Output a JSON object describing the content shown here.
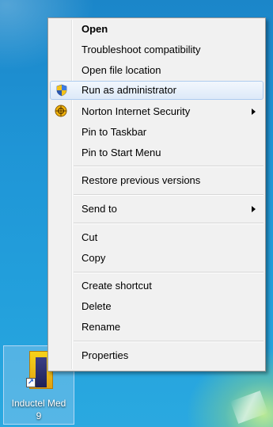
{
  "menu": {
    "items": [
      {
        "label": "Open"
      },
      {
        "label": "Troubleshoot compatibility"
      },
      {
        "label": "Open file location"
      },
      {
        "label": "Run as administrator",
        "icon": "uac-shield-icon"
      },
      {
        "label": "Norton Internet Security",
        "icon": "norton-icon"
      },
      {
        "label": "Pin to Taskbar"
      },
      {
        "label": "Pin to Start Menu"
      },
      {
        "label": "Restore previous versions"
      },
      {
        "label": "Send to"
      },
      {
        "label": "Cut"
      },
      {
        "label": "Copy"
      },
      {
        "label": "Create shortcut"
      },
      {
        "label": "Delete"
      },
      {
        "label": "Rename"
      },
      {
        "label": "Properties"
      }
    ],
    "hovered_item": "Run as administrator"
  },
  "desktop_icon": {
    "label_line1": "Inductel Med",
    "label_line2": "9",
    "icon": "inductel-app-icon"
  },
  "colors": {
    "desktop_blue": "#1f95d6",
    "menu_bg": "#f1f1f1",
    "hover_border": "#aeccef"
  }
}
